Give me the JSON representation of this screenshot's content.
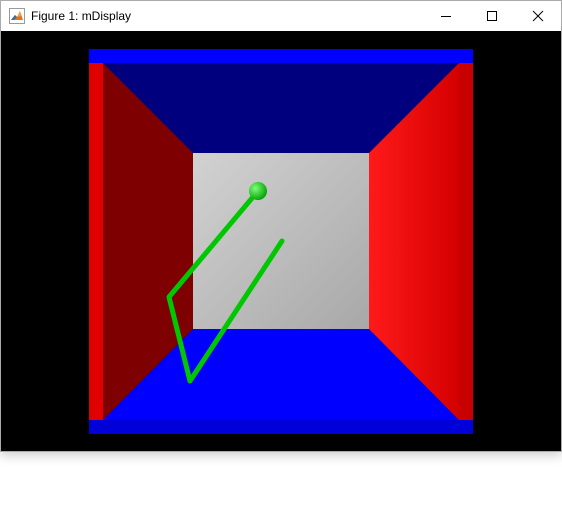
{
  "window": {
    "title": "Figure 1: mDisplay",
    "app_icon": "matlab-icon",
    "buttons": {
      "minimize": "minimize-icon",
      "maximize": "maximize-icon",
      "close": "close-icon"
    }
  },
  "scene": {
    "background_color": "#000000",
    "colors": {
      "frame": "#0000ff",
      "ceiling": "#00007f",
      "floor": "#0000ff",
      "left_wall": "#7f0000",
      "right_wall": "#ff0000",
      "back_wall": "#bebebe",
      "figure": "#00c800"
    }
  }
}
